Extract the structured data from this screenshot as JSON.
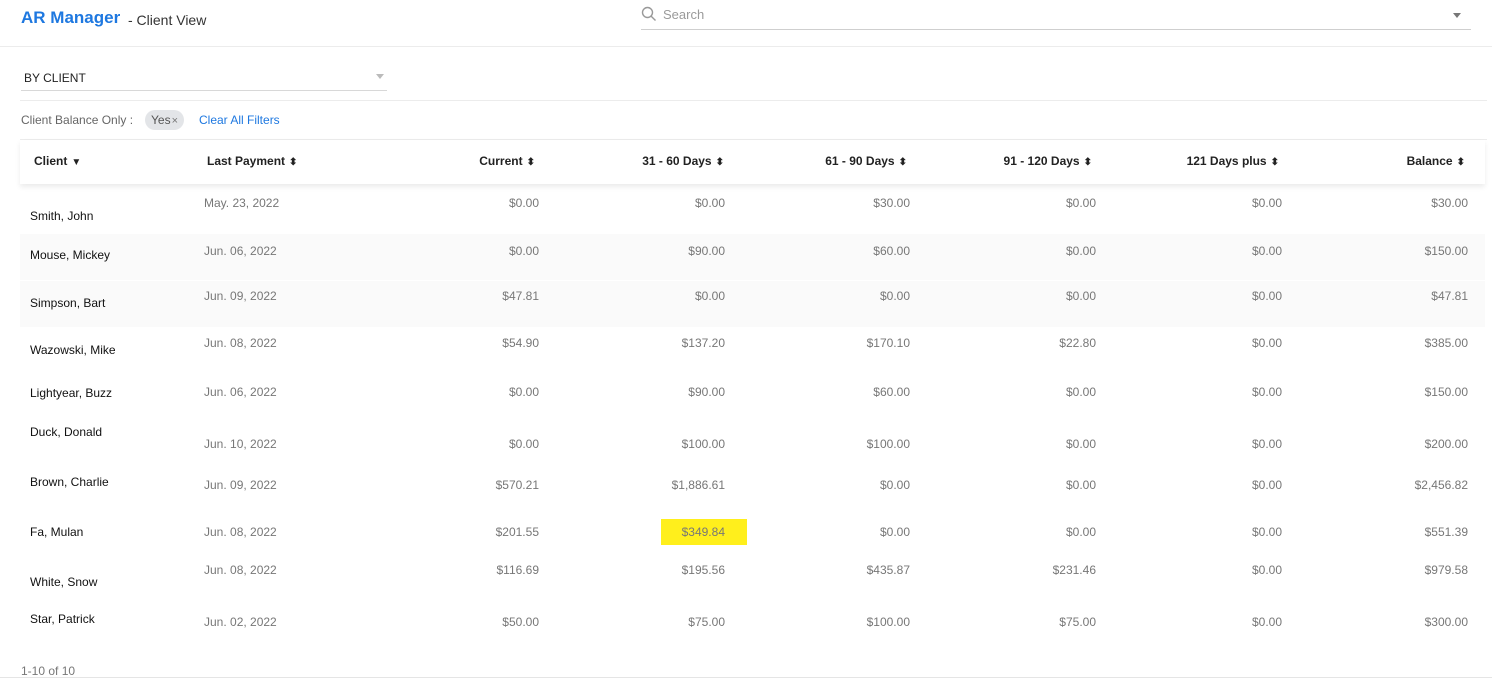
{
  "header": {
    "app_title": "AR Manager",
    "app_subtitle": "- Client View",
    "search_placeholder": "Search"
  },
  "group_by": {
    "value": "BY CLIENT"
  },
  "filters": {
    "label": "Client Balance Only :",
    "chip_value": "Yes",
    "chip_remove": "×",
    "clear_all": "Clear All Filters"
  },
  "table": {
    "columns": [
      {
        "label": "Client",
        "sort": "▼"
      },
      {
        "label": "Last Payment",
        "sort": "⬍"
      },
      {
        "label": "Current",
        "sort": "⬍"
      },
      {
        "label": "31 - 60 Days",
        "sort": "⬍"
      },
      {
        "label": "61 - 90 Days",
        "sort": "⬍"
      },
      {
        "label": "91 - 120 Days",
        "sort": "⬍"
      },
      {
        "label": "121 Days plus",
        "sort": "⬍"
      },
      {
        "label": "Balance",
        "sort": "⬍"
      }
    ],
    "rows": [
      [
        "Smith, John",
        "May. 23, 2022",
        "$0.00",
        "$0.00",
        "$30.00",
        "$0.00",
        "$0.00",
        "$30.00"
      ],
      [
        "Mouse, Mickey",
        "Jun. 06, 2022",
        "$0.00",
        "$90.00",
        "$60.00",
        "$0.00",
        "$0.00",
        "$150.00"
      ],
      [
        "Simpson, Bart",
        "Jun. 09, 2022",
        "$47.81",
        "$0.00",
        "$0.00",
        "$0.00",
        "$0.00",
        "$47.81"
      ],
      [
        "Wazowski, Mike",
        "Jun. 08, 2022",
        "$54.90",
        "$137.20",
        "$170.10",
        "$22.80",
        "$0.00",
        "$385.00"
      ],
      [
        "Lightyear, Buzz",
        "Jun. 06, 2022",
        "$0.00",
        "$90.00",
        "$60.00",
        "$0.00",
        "$0.00",
        "$150.00"
      ],
      [
        "Duck, Donald",
        "Jun. 10, 2022",
        "$0.00",
        "$100.00",
        "$100.00",
        "$0.00",
        "$0.00",
        "$200.00"
      ],
      [
        "Brown, Charlie",
        "Jun. 09, 2022",
        "$570.21",
        "$1,886.61",
        "$0.00",
        "$0.00",
        "$0.00",
        "$2,456.82"
      ],
      [
        "Fa, Mulan",
        "Jun. 08, 2022",
        "$201.55",
        "$349.84",
        "$0.00",
        "$0.00",
        "$0.00",
        "$551.39"
      ],
      [
        "White, Snow",
        "Jun. 08, 2022",
        "$116.69",
        "$195.56",
        "$435.87",
        "$231.46",
        "$0.00",
        "$979.58"
      ],
      [
        "Star, Patrick",
        "Jun. 02, 2022",
        "$50.00",
        "$75.00",
        "$100.00",
        "$75.00",
        "$0.00",
        "$300.00"
      ]
    ],
    "highlight_color": "#ffef1c"
  },
  "footer": {
    "count": "1-10 of 10"
  },
  "colors": {
    "accent": "#1e78e0"
  },
  "icons": {
    "search": "search-icon"
  }
}
